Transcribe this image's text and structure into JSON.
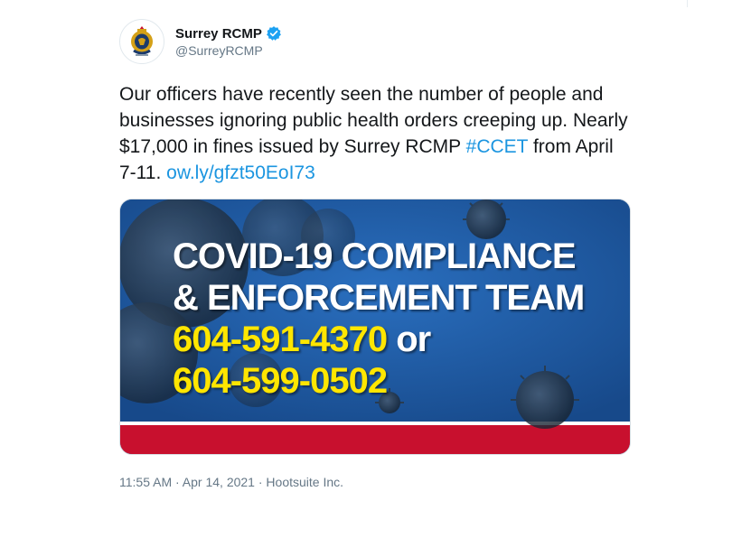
{
  "author": {
    "display_name": "Surrey RCMP",
    "handle": "@SurreyRCMP",
    "verified": true,
    "avatar_icon": "rcmp-crest-icon"
  },
  "tweet": {
    "text_main": "Our officers have recently seen the number of people and businesses ignoring public health orders creeping up. Nearly $17,000 in fines issued by Surrey RCMP ",
    "hashtag": "#CCET",
    "text_after_hashtag": " from April 7-11. ",
    "link": "ow.ly/gfzt50EoI73"
  },
  "media": {
    "line1": "COVID-19 COMPLIANCE",
    "line2": "& ENFORCEMENT TEAM",
    "phone1": "604-591-4370",
    "or_text": " or",
    "phone2": "604-599-0502",
    "colors": {
      "blue": "#1f5fa6",
      "red": "#c8102e",
      "yellow": "#ffe600"
    }
  },
  "meta": {
    "time": "11:55 AM",
    "separator1": " · ",
    "date": "Apr 14, 2021",
    "separator2": " · ",
    "source": "Hootsuite Inc."
  }
}
